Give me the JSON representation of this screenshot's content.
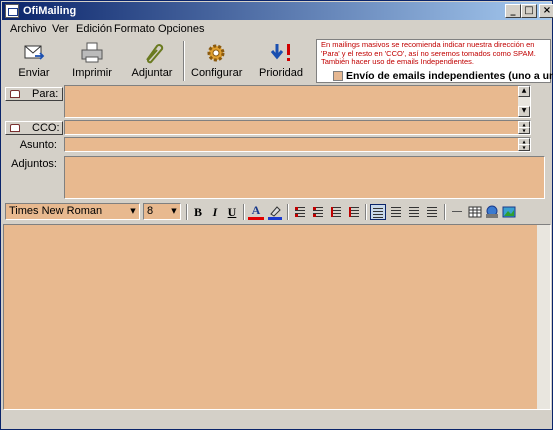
{
  "window": {
    "title": "OfiMailing"
  },
  "menu": [
    {
      "label": "Archivo"
    },
    {
      "label": "Ver"
    },
    {
      "label": "Edición"
    },
    {
      "label": "Formato"
    },
    {
      "label": "Opciones"
    }
  ],
  "toolbar": {
    "send": "Enviar",
    "print": "Imprimir",
    "attach": "Adjuntar",
    "configure": "Configurar",
    "priority": "Prioridad"
  },
  "notice": {
    "message": "En mailings masivos se recomienda indicar nuestra dirección en 'Para' y el resto en 'CCO', así no seremos tomados como SPAM. También hacer uso de emails Independientes.",
    "checkbox_label": "Envío de emails independientes (uno a uno)",
    "checkbox_checked": false
  },
  "fields": {
    "to_label": "Para:",
    "bcc_label": "CCO:",
    "subject_label": "Asunto:",
    "attachments_label": "Adjuntos:"
  },
  "format": {
    "font": "Times New Roman",
    "size": "8"
  },
  "colors": {
    "field_bg": "#e8b98f",
    "notice_text": "#c00000",
    "titlebar": "#0a246a"
  }
}
